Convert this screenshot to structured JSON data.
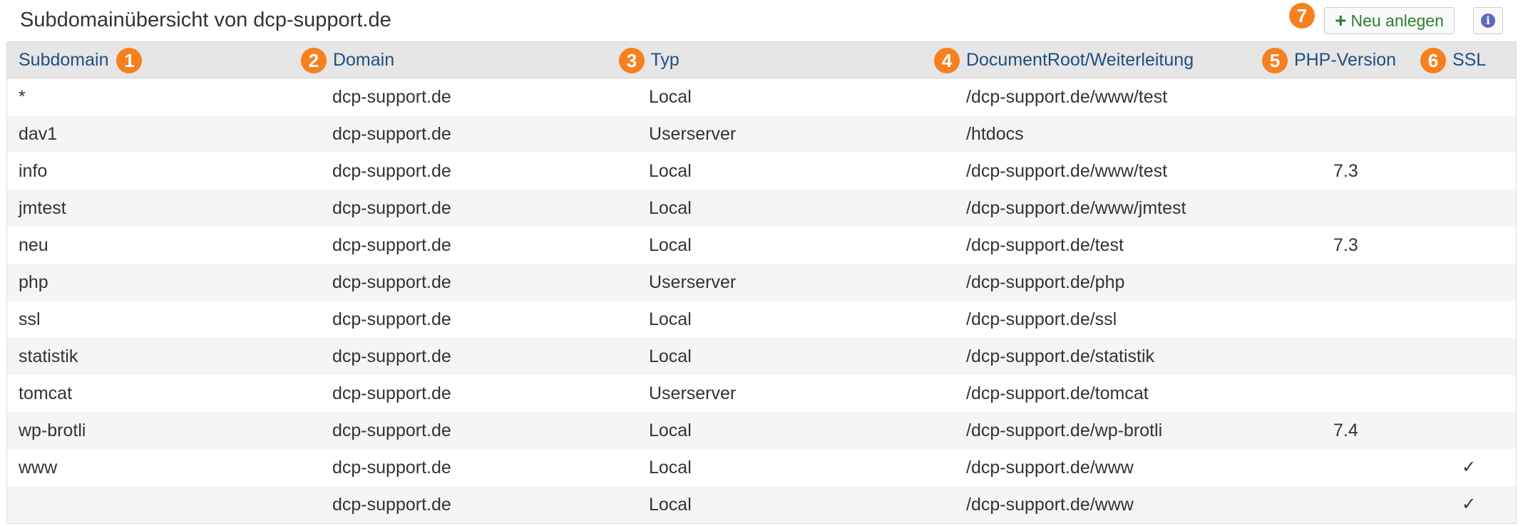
{
  "header": {
    "title": "Subdomainübersicht von dcp-support.de",
    "new_button_label": "Neu anlegen",
    "new_button_badge": "7",
    "info_label": "i"
  },
  "columns": [
    {
      "label": "Subdomain",
      "badge": "1"
    },
    {
      "label": "Domain",
      "badge": "2"
    },
    {
      "label": "Typ",
      "badge": "3"
    },
    {
      "label": "DocumentRoot/Weiterleitung",
      "badge": "4"
    },
    {
      "label": "PHP-Version",
      "badge": "5"
    },
    {
      "label": "SSL",
      "badge": "6"
    }
  ],
  "rows": [
    {
      "subdomain": "*",
      "domain": "dcp-support.de",
      "type": "Local",
      "docroot": "/dcp-support.de/www/test",
      "php": "",
      "ssl": ""
    },
    {
      "subdomain": "dav1",
      "domain": "dcp-support.de",
      "type": "Userserver",
      "docroot": "/htdocs",
      "php": "",
      "ssl": ""
    },
    {
      "subdomain": "info",
      "domain": "dcp-support.de",
      "type": "Local",
      "docroot": "/dcp-support.de/www/test",
      "php": "7.3",
      "ssl": ""
    },
    {
      "subdomain": "jmtest",
      "domain": "dcp-support.de",
      "type": "Local",
      "docroot": "/dcp-support.de/www/jmtest",
      "php": "",
      "ssl": ""
    },
    {
      "subdomain": "neu",
      "domain": "dcp-support.de",
      "type": "Local",
      "docroot": "/dcp-support.de/test",
      "php": "7.3",
      "ssl": ""
    },
    {
      "subdomain": "php",
      "domain": "dcp-support.de",
      "type": "Userserver",
      "docroot": "/dcp-support.de/php",
      "php": "",
      "ssl": ""
    },
    {
      "subdomain": "ssl",
      "domain": "dcp-support.de",
      "type": "Local",
      "docroot": "/dcp-support.de/ssl",
      "php": "",
      "ssl": ""
    },
    {
      "subdomain": "statistik",
      "domain": "dcp-support.de",
      "type": "Local",
      "docroot": "/dcp-support.de/statistik",
      "php": "",
      "ssl": ""
    },
    {
      "subdomain": "tomcat",
      "domain": "dcp-support.de",
      "type": "Userserver",
      "docroot": "/dcp-support.de/tomcat",
      "php": "",
      "ssl": ""
    },
    {
      "subdomain": "wp-brotli",
      "domain": "dcp-support.de",
      "type": "Local",
      "docroot": "/dcp-support.de/wp-brotli",
      "php": "7.4",
      "ssl": ""
    },
    {
      "subdomain": "www",
      "domain": "dcp-support.de",
      "type": "Local",
      "docroot": "/dcp-support.de/www",
      "php": "",
      "ssl": "✓"
    },
    {
      "subdomain": "",
      "domain": "dcp-support.de",
      "type": "Local",
      "docroot": "/dcp-support.de/www",
      "php": "",
      "ssl": "✓"
    }
  ],
  "colors": {
    "badge": "#f7801e",
    "header_text": "#1f4f82",
    "button_text": "#2e7d32",
    "info_icon": "#5c6bc0"
  },
  "icons": {
    "new_button": "plus-icon",
    "info_button": "info-icon"
  }
}
